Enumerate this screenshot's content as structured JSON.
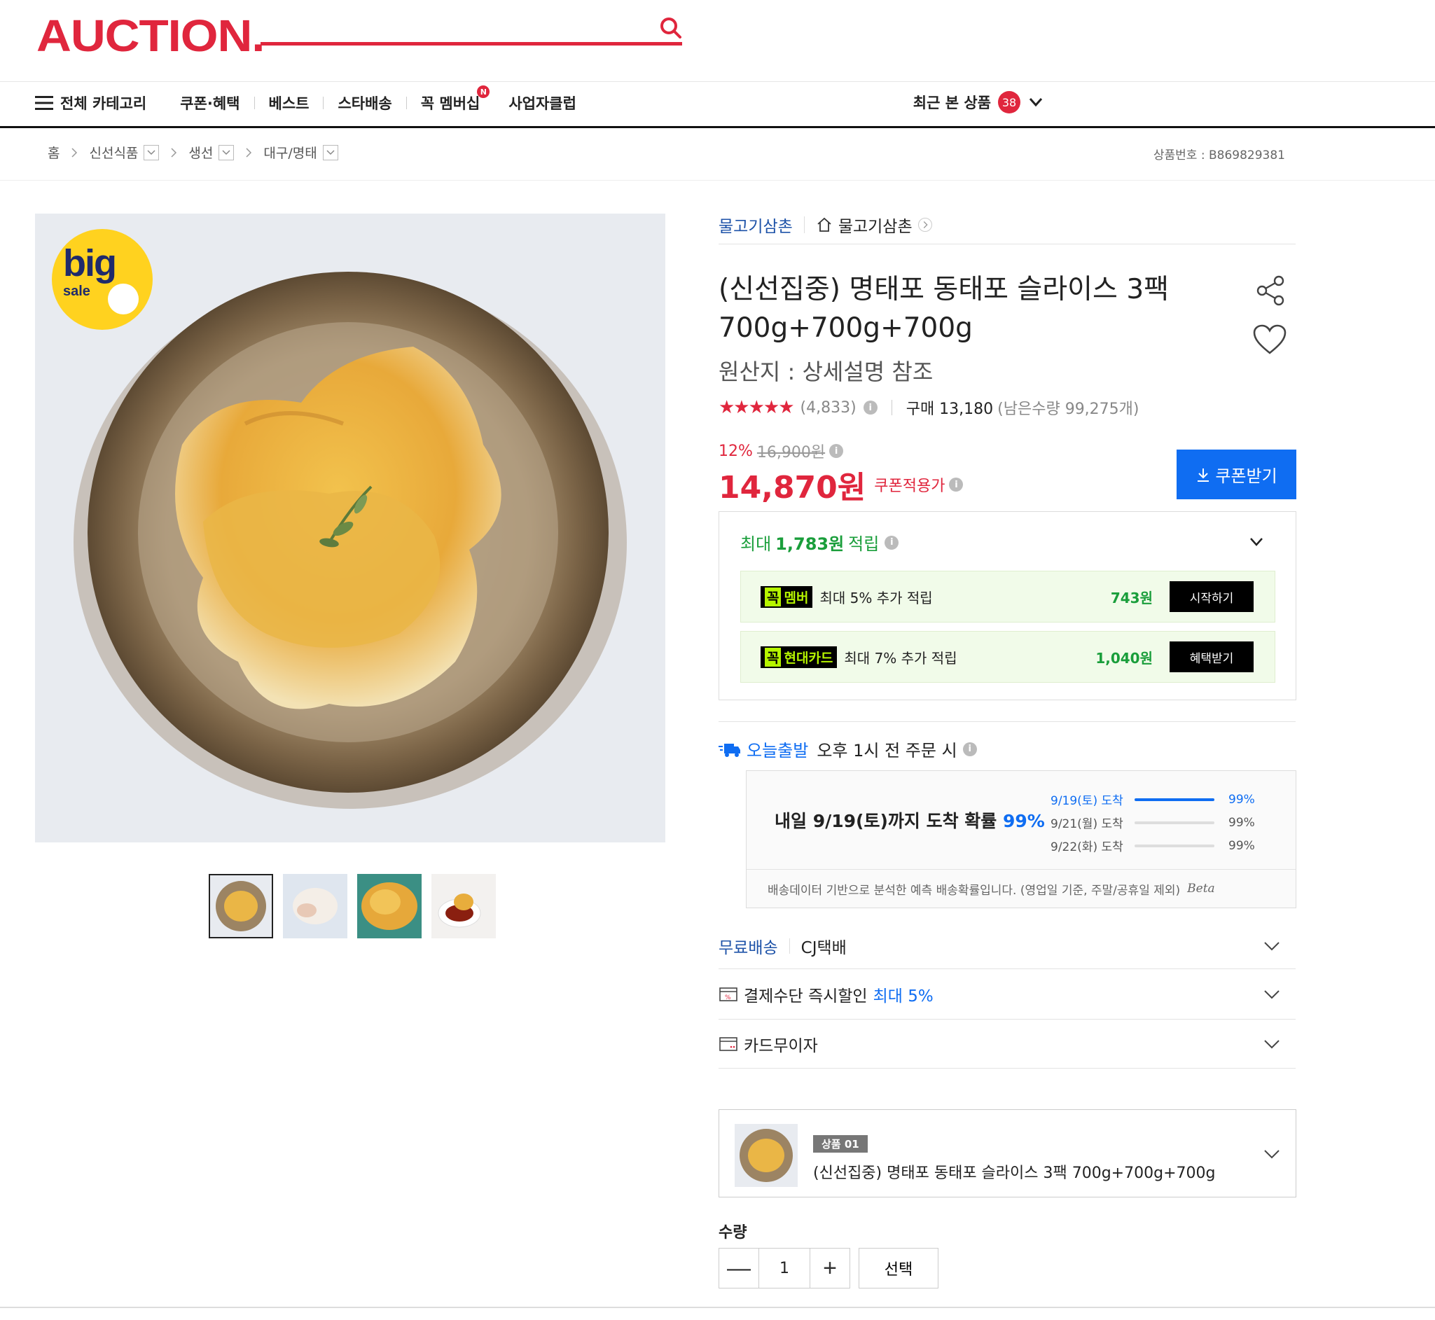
{
  "header": {
    "logo": "AUCTION.",
    "brand_color": "#e0263d"
  },
  "nav": {
    "all_categories": "전체 카테고리",
    "items": [
      "쿠폰·혜택",
      "베스트",
      "스타배송",
      "꼭 멤버십",
      "사업자클럽"
    ],
    "membership_badge": "N",
    "recent_label": "최근 본 상품",
    "recent_count": "38"
  },
  "breadcrumb": {
    "items": [
      "홈",
      "신선식품",
      "생선",
      "대구/명태"
    ],
    "product_number": "상품번호 : B869829381"
  },
  "product": {
    "seller": "물고기삼촌",
    "store": "물고기삼촌",
    "title": "(신선집중) 명태포 동태포 슬라이스 3팩 700g+700g+700g",
    "origin": "원산지 : 상세설명 참조",
    "stars": "★★★★★",
    "rating": 4.5,
    "review_count": "(4,833)",
    "purchase": "구매 13,180",
    "stock": "(남은수량 99,275개)",
    "discount_pct": "12%",
    "original_price": "16,900원",
    "price": "14,870원",
    "coupon_applied": "쿠폰적용가",
    "coupon_button": "쿠폰받기",
    "badge": "big sale"
  },
  "rewards": {
    "head_prefix": "최대",
    "head_amount": "1,783원",
    "head_suffix": "적립",
    "rows": [
      {
        "tag_k": "꼭",
        "tag": "멤버",
        "text": "최대 5% 추가 적립",
        "amount": "743원",
        "button": "시작하기"
      },
      {
        "tag_k": "꼭",
        "tag": "현대카드",
        "text": "최대 7% 추가 적립",
        "amount": "1,040원",
        "button": "혜택받기"
      }
    ]
  },
  "delivery": {
    "today_label": "오늘출발",
    "today_text": "오후 1시 전 주문 시",
    "main_prefix": "내일 9/19(토)까지 도착 확률",
    "main_pct": "99%",
    "rows": [
      {
        "date": "9/19(토) 도착",
        "pct": "99%",
        "fill": 1.0
      },
      {
        "date": "9/21(월) 도착",
        "pct": "99%",
        "fill": 0.0
      },
      {
        "date": "9/22(화) 도착",
        "pct": "99%",
        "fill": 0.0
      }
    ],
    "footnote": "배송데이터 기반으로 분석한 예측 배송확률입니다. (영업일 기준, 주말/공휴일 제외)",
    "beta": "Beta"
  },
  "options": {
    "free_shipping": "무료배송",
    "courier": "CJ택배",
    "payment_discount": "결제수단 즉시할인",
    "payment_max": "최대 5%",
    "card_interest": "카드무이자"
  },
  "selected": {
    "tag": "상품 01",
    "name": "(신선집중) 명태포 동태포 슬라이스 3팩 700g+700g+700g"
  },
  "quantity": {
    "label": "수량",
    "minus": "—",
    "value": "1",
    "plus": "+",
    "select": "선택"
  }
}
